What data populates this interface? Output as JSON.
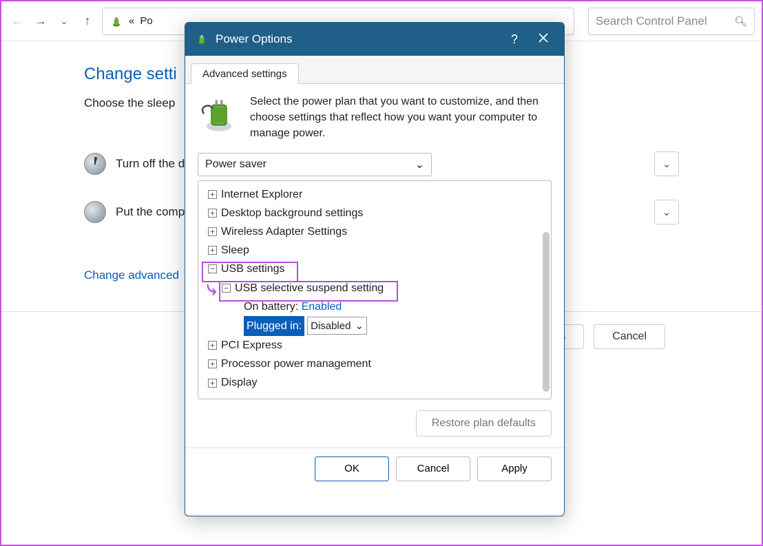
{
  "toolbar": {
    "breadcrumb_prefix": "«",
    "breadcrumb_text": "Po",
    "search_placeholder": "Search Control Panel"
  },
  "cp": {
    "heading": "Change setti",
    "subtitle": "Choose the sleep",
    "row_display": "Turn off the d",
    "row_sleep": "Put the comp",
    "link_advanced": "Change advanced",
    "btn_save_suffix": "s",
    "btn_cancel": "Cancel"
  },
  "modal": {
    "title": "Power Options",
    "help": "?",
    "tab": "Advanced settings",
    "intro": "Select the power plan that you want to customize, and then choose settings that reflect how you want your computer to manage power.",
    "plan_selected": "Power saver",
    "tree": {
      "ie": "Internet Explorer",
      "desktop": "Desktop background settings",
      "wifi": "Wireless Adapter Settings",
      "sleep": "Sleep",
      "usb": "USB settings",
      "usb_sub": "USB selective suspend setting",
      "on_battery_label": "On battery:",
      "on_battery_value": "Enabled",
      "plugged_label": "Plugged in:",
      "plugged_value": "Disabled",
      "pci": "PCI Express",
      "proc": "Processor power management",
      "display": "Display"
    },
    "btn_restore": "Restore plan defaults",
    "btn_ok": "OK",
    "btn_cancel": "Cancel",
    "btn_apply": "Apply"
  }
}
